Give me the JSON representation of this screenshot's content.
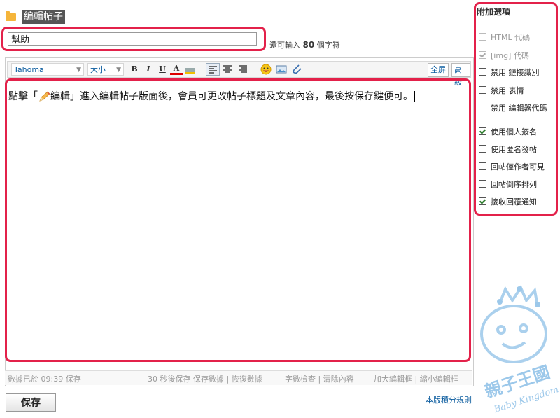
{
  "header": {
    "title": "編輯帖子"
  },
  "subject": {
    "value": "幫助",
    "remaining_prefix": "還可輸入",
    "remaining_count": "80",
    "remaining_suffix": "個字符"
  },
  "toolbar": {
    "font": "Tahoma",
    "size": "大小",
    "bold": "B",
    "italic": "I",
    "underline": "U",
    "color": "A",
    "fullscreen": "全屏",
    "advanced": "高級"
  },
  "editor": {
    "text_before": "點擊「",
    "text_edit": "編輯",
    "text_after": "」進入編輯帖子版面後，會員可更改帖子標題及文章內容，最後按保存鍵便可。"
  },
  "statusbar": {
    "autosave": "數據已於 09:39 保存",
    "save_in": "30 秒後保存 保存數據 | 恢復數據",
    "wordcount": "字數檢查 | 清除內容",
    "resize": "加大編輯框 | 縮小編輯框"
  },
  "buttons": {
    "save": "保存"
  },
  "links": {
    "rules": "本版積分規則"
  },
  "options": {
    "title": "附加選項",
    "items": [
      {
        "label": "HTML 代碼",
        "checked": false,
        "disabled": true
      },
      {
        "label": "[img] 代碼",
        "checked": true,
        "disabled": true
      },
      {
        "label": "禁用 鏈接識別",
        "checked": false,
        "disabled": false
      },
      {
        "label": "禁用 表情",
        "checked": false,
        "disabled": false
      },
      {
        "label": "禁用 編輯器代碼",
        "checked": false,
        "disabled": false
      },
      {
        "label": "使用個人簽名",
        "checked": true,
        "disabled": false
      },
      {
        "label": "使用匿名發帖",
        "checked": false,
        "disabled": false
      },
      {
        "label": "回帖僅作者可見",
        "checked": false,
        "disabled": false
      },
      {
        "label": "回帖倒序排列",
        "checked": false,
        "disabled": false
      },
      {
        "label": "接收回覆通知",
        "checked": true,
        "disabled": false
      }
    ]
  },
  "logo": {
    "text_cn": "親子王國",
    "text_en": "Baby Kingdom"
  },
  "colors": {
    "highlight": "#e3214a",
    "link": "#0a5b9e",
    "logo": "#9cc8ea"
  }
}
